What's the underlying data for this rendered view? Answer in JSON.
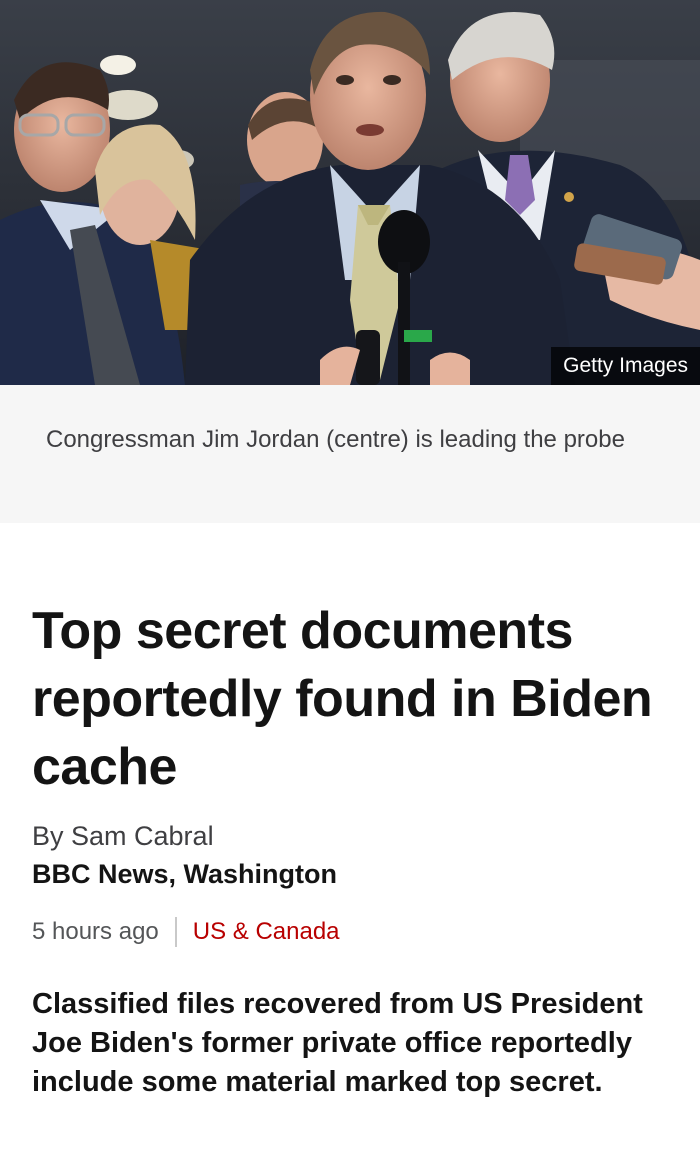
{
  "image": {
    "credit": "Getty Images",
    "caption": "Congressman Jim Jordan (centre) is leading the probe"
  },
  "article": {
    "headline": "Top secret documents reportedly found in Biden cache",
    "byline": "By Sam Cabral",
    "organization": "BBC News, Washington",
    "timestamp": "5 hours ago",
    "section": "US & Canada",
    "summary": "Classified files recovered from US President Joe Biden's former private office reportedly include some material marked top secret."
  },
  "colors": {
    "section_link": "#b80000",
    "caption_background": "#f6f6f6"
  }
}
